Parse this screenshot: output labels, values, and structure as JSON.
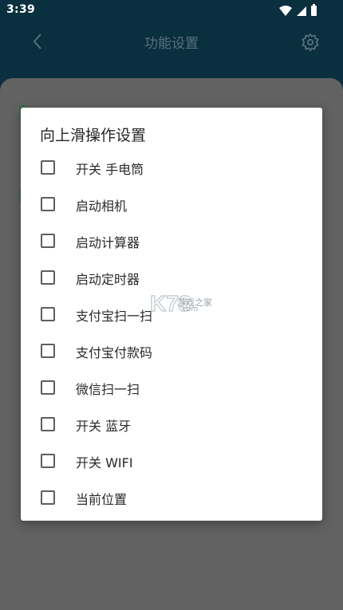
{
  "status_bar": {
    "time": "3:39",
    "icons": [
      "wifi-icon",
      "signal-icon",
      "battery-icon"
    ]
  },
  "app_bar": {
    "title": "功能设置",
    "back_icon": "chevron-left-icon",
    "settings_icon": "gear-icon"
  },
  "dialog": {
    "title": "向上滑操作设置",
    "options": [
      {
        "label": "开关 手电筒",
        "checked": false
      },
      {
        "label": "启动相机",
        "checked": false
      },
      {
        "label": "启动计算器",
        "checked": false
      },
      {
        "label": "启动定时器",
        "checked": false
      },
      {
        "label": "支付宝扫一扫",
        "checked": false
      },
      {
        "label": "支付宝付款码",
        "checked": false
      },
      {
        "label": "微信扫一扫",
        "checked": false
      },
      {
        "label": "开关 蓝牙",
        "checked": false
      },
      {
        "label": "开关 WIFI",
        "checked": false
      },
      {
        "label": "当前位置",
        "checked": false
      }
    ]
  },
  "watermark": {
    "logo_text": "K73",
    "text": "游戏之家",
    "sub": ".com"
  },
  "colors": {
    "header_bg": "#0a2f3f",
    "scrim": "#626262",
    "dialog_bg": "#ffffff",
    "checkbox_border": "#5e5e5e"
  }
}
